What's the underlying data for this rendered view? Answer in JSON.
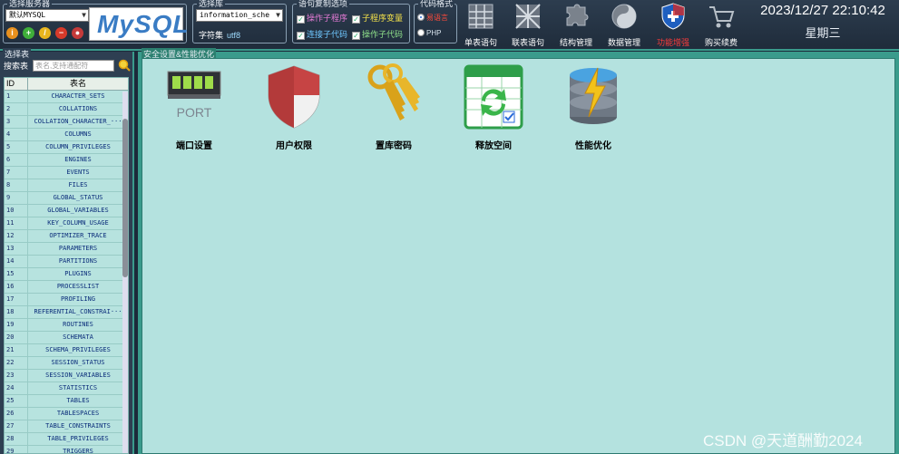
{
  "server": {
    "legend": "选择服务器",
    "selected": "默认MYSQL",
    "logo_text": "MySQL"
  },
  "database": {
    "legend": "选择库",
    "selected": "information_sche",
    "charset_label": "字符集",
    "charset_value": "utf8"
  },
  "copy_options": {
    "legend": "语句复制选项",
    "items": [
      {
        "label": "操作子程序",
        "color": "#e57bd6"
      },
      {
        "label": "子程序变量",
        "color": "#f3e14a"
      },
      {
        "label": "连接子代码",
        "color": "#6fc7ff"
      },
      {
        "label": "操作子代码",
        "color": "#8fe08a"
      }
    ]
  },
  "code_format": {
    "legend": "代码格式",
    "opt1": "易语言",
    "opt2": "PHP"
  },
  "toolbar": [
    {
      "label": "单表语句",
      "icon": "grid-icon"
    },
    {
      "label": "联表语句",
      "icon": "crossed-grid-icon"
    },
    {
      "label": "结构管理",
      "icon": "puzzle-icon"
    },
    {
      "label": "数据管理",
      "icon": "disk-icon"
    },
    {
      "label": "功能增强",
      "icon": "shield-icon"
    },
    {
      "label": "购买续费",
      "icon": "cart-icon"
    }
  ],
  "clock": {
    "datetime": "2023/12/27 22:10:42",
    "weekday": "星期三"
  },
  "table_panel": {
    "legend": "选择表",
    "search_label": "搜索表",
    "search_placeholder": "表名,支持通配符",
    "columns": [
      "ID",
      "表名"
    ],
    "rows": [
      [
        "1",
        "CHARACTER_SETS"
      ],
      [
        "2",
        "COLLATIONS"
      ],
      [
        "3",
        "COLLATION_CHARACTER_···"
      ],
      [
        "4",
        "COLUMNS"
      ],
      [
        "5",
        "COLUMN_PRIVILEGES"
      ],
      [
        "6",
        "ENGINES"
      ],
      [
        "7",
        "EVENTS"
      ],
      [
        "8",
        "FILES"
      ],
      [
        "9",
        "GLOBAL_STATUS"
      ],
      [
        "10",
        "GLOBAL_VARIABLES"
      ],
      [
        "11",
        "KEY_COLUMN_USAGE"
      ],
      [
        "12",
        "OPTIMIZER_TRACE"
      ],
      [
        "13",
        "PARAMETERS"
      ],
      [
        "14",
        "PARTITIONS"
      ],
      [
        "15",
        "PLUGINS"
      ],
      [
        "16",
        "PROCESSLIST"
      ],
      [
        "17",
        "PROFILING"
      ],
      [
        "18",
        "REFERENTIAL_CONSTRAI···"
      ],
      [
        "19",
        "ROUTINES"
      ],
      [
        "20",
        "SCHEMATA"
      ],
      [
        "21",
        "SCHEMA_PRIVILEGES"
      ],
      [
        "22",
        "SESSION_STATUS"
      ],
      [
        "23",
        "SESSION_VARIABLES"
      ],
      [
        "24",
        "STATISTICS"
      ],
      [
        "25",
        "TABLES"
      ],
      [
        "26",
        "TABLESPACES"
      ],
      [
        "27",
        "TABLE_CONSTRAINTS"
      ],
      [
        "28",
        "TABLE_PRIVILEGES"
      ],
      [
        "29",
        "TRIGGERS"
      ]
    ]
  },
  "main": {
    "legend": "安全设置&性能优化",
    "cards": [
      {
        "label": "端口设置",
        "icon": "port-icon",
        "icon_text": "PORT"
      },
      {
        "label": "用户权限",
        "icon": "shield-icon"
      },
      {
        "label": "置库密码",
        "icon": "keys-icon"
      },
      {
        "label": "释放空间",
        "icon": "recycle-sheet-icon"
      },
      {
        "label": "性能优化",
        "icon": "database-lightning-icon"
      }
    ]
  },
  "watermark": "CSDN @天道酬勤2024"
}
